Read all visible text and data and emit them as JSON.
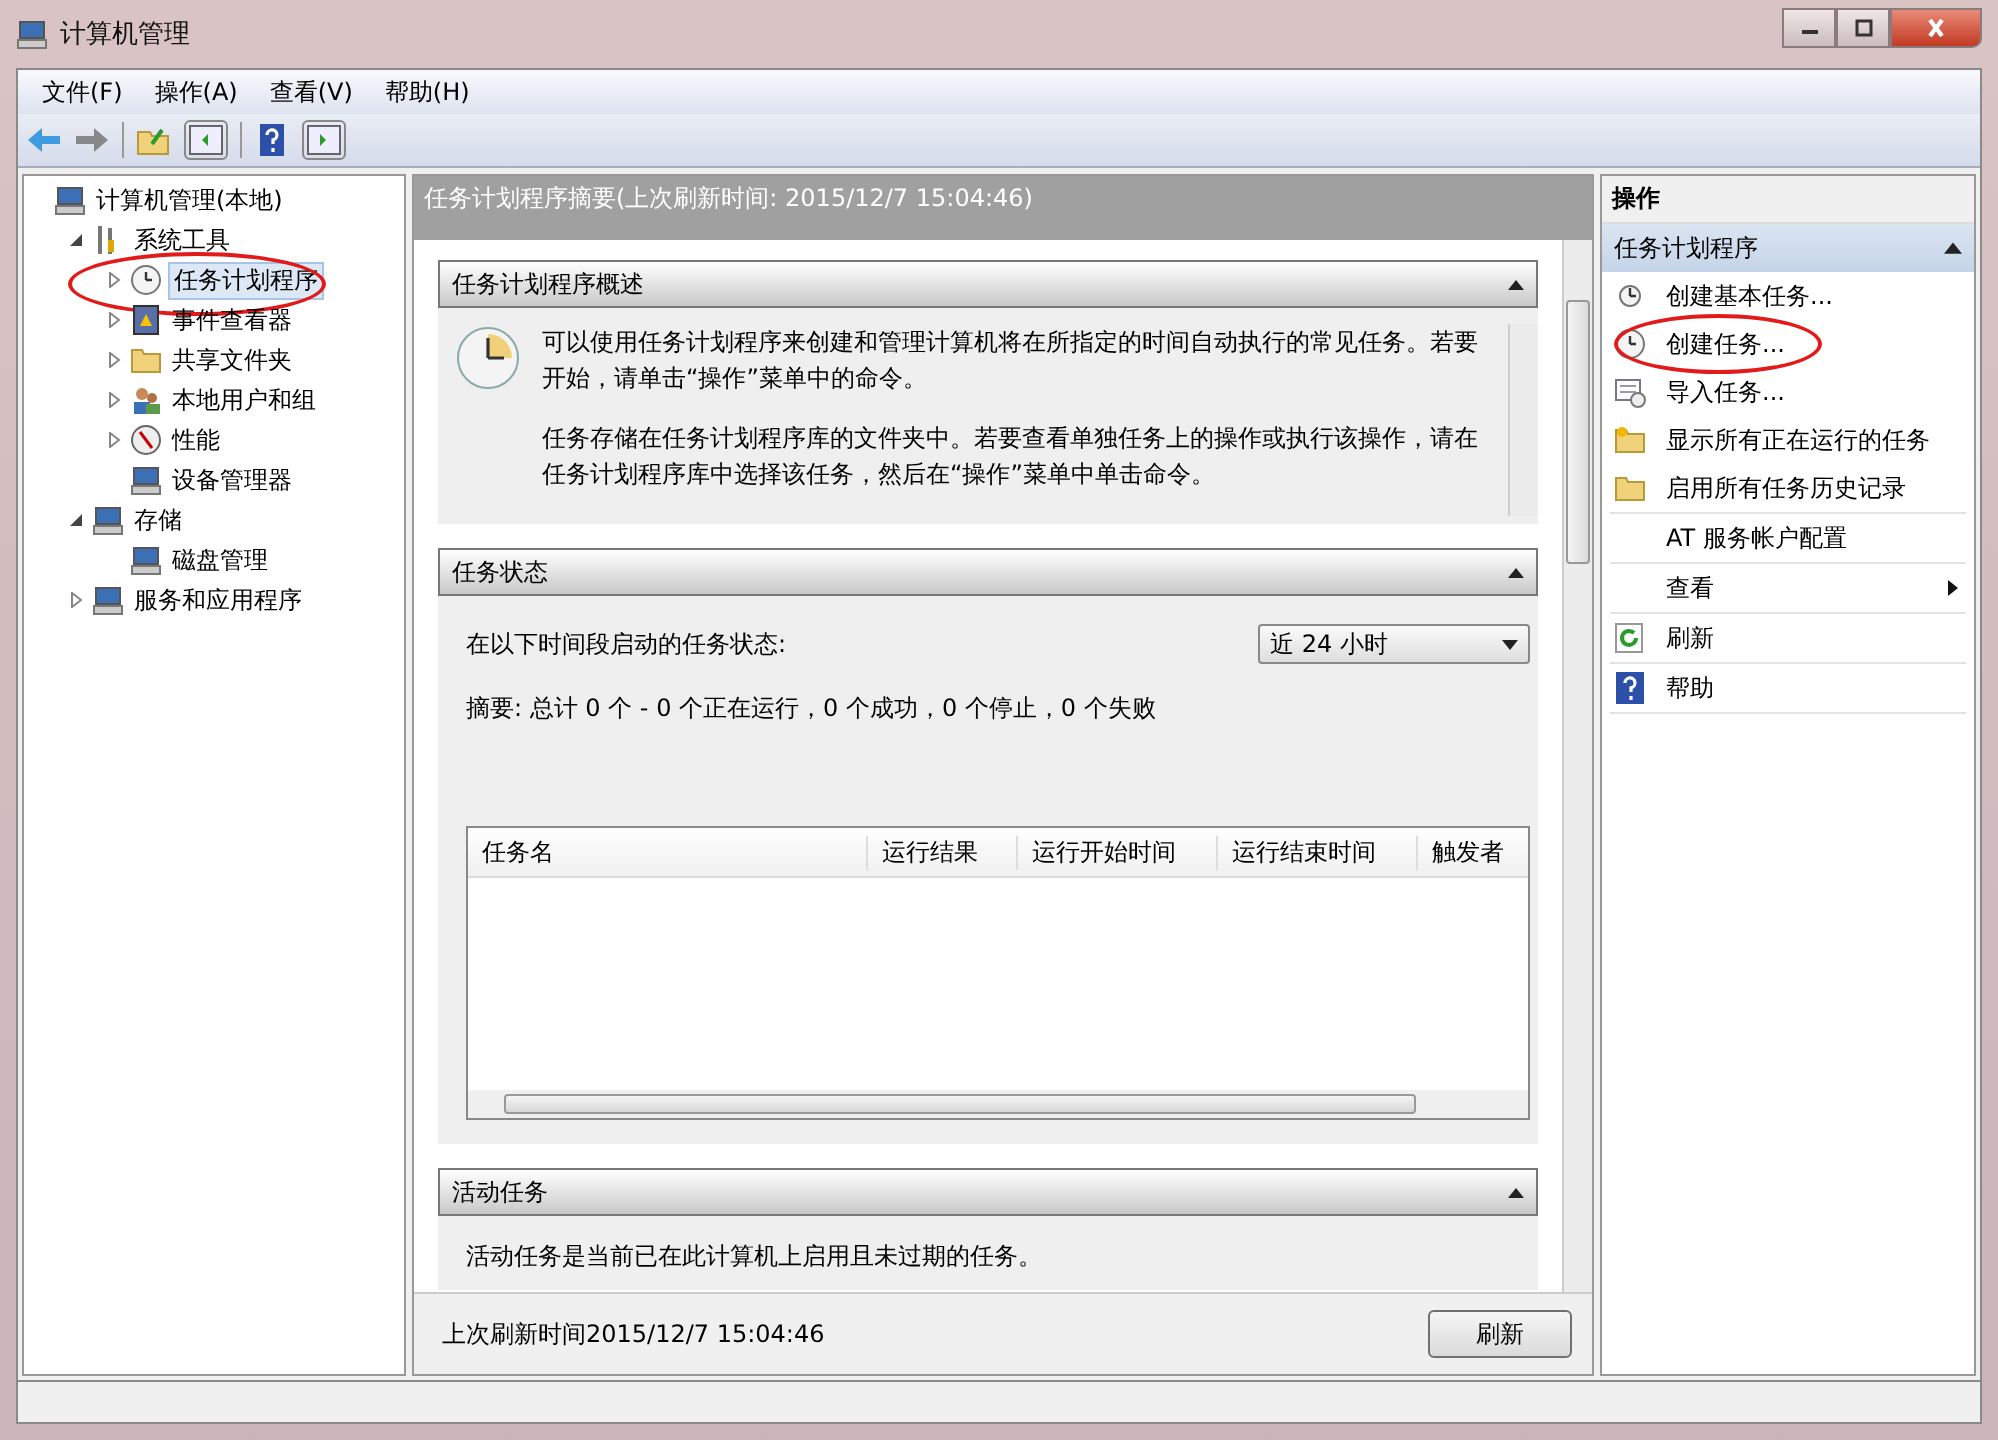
{
  "window": {
    "title": "计算机管理"
  },
  "menu": [
    "文件(F)",
    "操作(A)",
    "查看(V)",
    "帮助(H)"
  ],
  "tree": [
    {
      "label": "计算机管理(本地)",
      "kind": "computer",
      "selected": false,
      "circled": false,
      "children": [
        {
          "label": "系统工具",
          "kind": "tools",
          "expanded": true,
          "selected": false,
          "circled": false,
          "children": [
            {
              "label": "任务计划程序",
              "kind": "clock",
              "expanded": false,
              "selected": true,
              "circled": true
            },
            {
              "label": "事件查看器",
              "kind": "book",
              "expanded": false,
              "selected": false,
              "circled": false
            },
            {
              "label": "共享文件夹",
              "kind": "folder",
              "expanded": false,
              "selected": false,
              "circled": false
            },
            {
              "label": "本地用户和组",
              "kind": "users",
              "expanded": false,
              "selected": false,
              "circled": false
            },
            {
              "label": "性能",
              "kind": "gauge",
              "expanded": false,
              "selected": false,
              "circled": false
            },
            {
              "label": "设备管理器",
              "kind": "device",
              "selected": false,
              "circled": false
            }
          ]
        },
        {
          "label": "存储",
          "kind": "storage",
          "expanded": true,
          "selected": false,
          "circled": false,
          "children": [
            {
              "label": "磁盘管理",
              "kind": "disk",
              "selected": false,
              "circled": false
            }
          ]
        },
        {
          "label": "服务和应用程序",
          "kind": "server",
          "expanded": false,
          "selected": false,
          "circled": false
        }
      ]
    }
  ],
  "center": {
    "header": "任务计划程序摘要(上次刷新时间: 2015/12/7 15:04:46)",
    "overview": {
      "title": "任务计划程序概述",
      "expanded": true,
      "paragraphs": [
        "可以使用任务计划程序来创建和管理计算机将在所指定的时间自动执行的常见任务。若要开始，请单击“操作”菜单中的命令。",
        "任务存储在任务计划程序库的文件夹中。若要查看单独任务上的操作或执行该操作，请在任务计划程序库中选择该任务，然后在“操作”菜单中单击命令。"
      ]
    },
    "status": {
      "title": "任务状态",
      "expanded": true,
      "period_label": "在以下时间段启动的任务状态:",
      "period_value": "近 24 小时",
      "summary": "摘要: 总计 0 个 - 0 个正在运行，0 个成功，0 个停止，0 个失败",
      "columns": [
        "任务名",
        "运行结果",
        "运行开始时间",
        "运行结束时间",
        "触发者"
      ]
    },
    "active": {
      "title": "活动任务",
      "expanded": true,
      "text": "活动任务是当前已在此计算机上启用且未过期的任务。"
    },
    "footer": {
      "text": "上次刷新时间2015/12/7 15:04:46",
      "button": "刷新"
    }
  },
  "actions": {
    "title": "操作",
    "section": "任务计划程序",
    "groups": [
      [
        {
          "label": "创建基本任务...",
          "kind": "clock-small",
          "circled": false
        },
        {
          "label": "创建任务...",
          "kind": "clock",
          "circled": true
        },
        {
          "label": "导入任务...",
          "kind": "import",
          "circled": false
        },
        {
          "label": "显示所有正在运行的任务",
          "kind": "folder-star",
          "circled": false
        },
        {
          "label": "启用所有任务历史记录",
          "kind": "folder",
          "circled": false
        }
      ],
      [
        {
          "label": "AT 服务帐户配置",
          "kind": "none",
          "circled": false
        }
      ],
      [
        {
          "label": "查看",
          "kind": "none",
          "submenu": true,
          "circled": false
        }
      ],
      [
        {
          "label": "刷新",
          "kind": "refresh",
          "circled": false
        }
      ],
      [
        {
          "label": "帮助",
          "kind": "help",
          "circled": false
        }
      ]
    ]
  }
}
